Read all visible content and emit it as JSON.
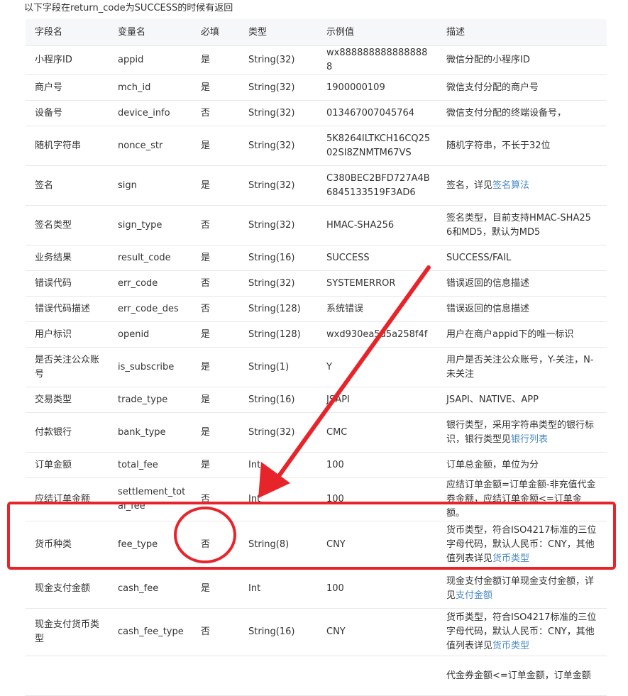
{
  "intro_text": "以下字段在return_code为SUCCESS的时候有返回",
  "headers": [
    "字段名",
    "变量名",
    "必填",
    "类型",
    "示例值",
    "描述"
  ],
  "rows": [
    {
      "field": "小程序ID",
      "var": "appid",
      "req": "是",
      "type": "String(32)",
      "example": "wx8888888888888888",
      "desc": "微信分配的小程序ID",
      "h": 1
    },
    {
      "field": "商户号",
      "var": "mch_id",
      "req": "是",
      "type": "String(32)",
      "example": "1900000109",
      "desc": "微信支付分配的商户号",
      "h": 1
    },
    {
      "field": "设备号",
      "var": "device_info",
      "req": "否",
      "type": "String(32)",
      "example": "013467007045764",
      "desc": "微信支付分配的终端设备号，",
      "h": 1
    },
    {
      "field": "随机字符串",
      "var": "nonce_str",
      "req": "是",
      "type": "String(32)",
      "example": "5K8264ILTKCH16CQ2502SI8ZNMTM67VS",
      "desc": "随机字符串，不长于32位",
      "h": 2
    },
    {
      "field": "签名",
      "var": "sign",
      "req": "是",
      "type": "String(32)",
      "example": "C380BEC2BFD727A4B6845133519F3AD6",
      "desc": "签名，详见",
      "link": "签名算法",
      "h": 2
    },
    {
      "field": "签名类型",
      "var": "sign_type",
      "req": "否",
      "type": "String(32)",
      "example": "HMAC-SHA256",
      "desc": "签名类型，目前支持HMAC-SHA256和MD5，默认为MD5",
      "h": 2
    },
    {
      "field": "业务结果",
      "var": "result_code",
      "req": "是",
      "type": "String(16)",
      "example": "SUCCESS",
      "desc": "SUCCESS/FAIL",
      "h": 1
    },
    {
      "field": "错误代码",
      "var": "err_code",
      "req": "否",
      "type": "String(32)",
      "example": "SYSTEMERROR",
      "desc": "错误返回的信息描述",
      "h": 1
    },
    {
      "field": "错误代码描述",
      "var": "err_code_des",
      "req": "否",
      "type": "String(128)",
      "example": "系统错误",
      "desc": "错误返回的信息描述",
      "h": 1
    },
    {
      "field": "用户标识",
      "var": "openid",
      "req": "是",
      "type": "String(128)",
      "example": "wxd930ea5d5a258f4f",
      "desc": "用户在商户appid下的唯一标识",
      "h": 1
    },
    {
      "field": "是否关注公众账号",
      "var": "is_subscribe",
      "req": "是",
      "type": "String(1)",
      "example": "Y",
      "desc": "用户是否关注公众账号，Y-关注，N-未关注",
      "h": 2
    },
    {
      "field": "交易类型",
      "var": "trade_type",
      "req": "是",
      "type": "String(16)",
      "example": "JSAPI",
      "desc": "JSAPI、NATIVE、APP",
      "h": 1
    },
    {
      "field": "付款银行",
      "var": "bank_type",
      "req": "是",
      "type": "String(32)",
      "example": "CMC",
      "desc": "银行类型，采用字符串类型的银行标识，银行类型见",
      "link": "银行列表",
      "h": 2
    },
    {
      "field": "订单金额",
      "var": "total_fee",
      "req": "是",
      "type": "Int",
      "example": "100",
      "desc": "订单总金额，单位为分",
      "h": 1
    },
    {
      "field": "应结订单金额",
      "var": "settlement_total_fee",
      "req": "否",
      "type": "Int",
      "example": "100",
      "desc": "应结订单金额=订单金额-非充值代金券金额，应结订单金额<=订单金额。",
      "h": 2
    },
    {
      "field": "货币种类",
      "var": "fee_type",
      "req": "否",
      "type": "String(8)",
      "example": "CNY",
      "desc": "货币类型，符合ISO4217标准的三位字母代码，默认人民币：CNY，其他值列表详见",
      "link": "货币类型",
      "h": 3
    },
    {
      "field": "现金支付金额",
      "var": "cash_fee",
      "req": "是",
      "type": "Int",
      "example": "100",
      "desc": "现金支付金额订单现金支付金额，详见",
      "link": "支付金额",
      "h": 2
    },
    {
      "field": "现金支付货币类型",
      "var": "cash_fee_type",
      "req": "否",
      "type": "String(16)",
      "example": "CNY",
      "desc": "货币类型，符合ISO4217标准的三位字母代码，默认人民币：CNY，其他值列表详见",
      "link": "货币类型",
      "h": 3
    },
    {
      "field": "",
      "var": "",
      "req": "",
      "type": "",
      "example": "",
      "desc": "代金券金额<=订单金额，订单金额",
      "h": 2
    }
  ],
  "annotation_colors": {
    "highlight": "#e8242b"
  }
}
